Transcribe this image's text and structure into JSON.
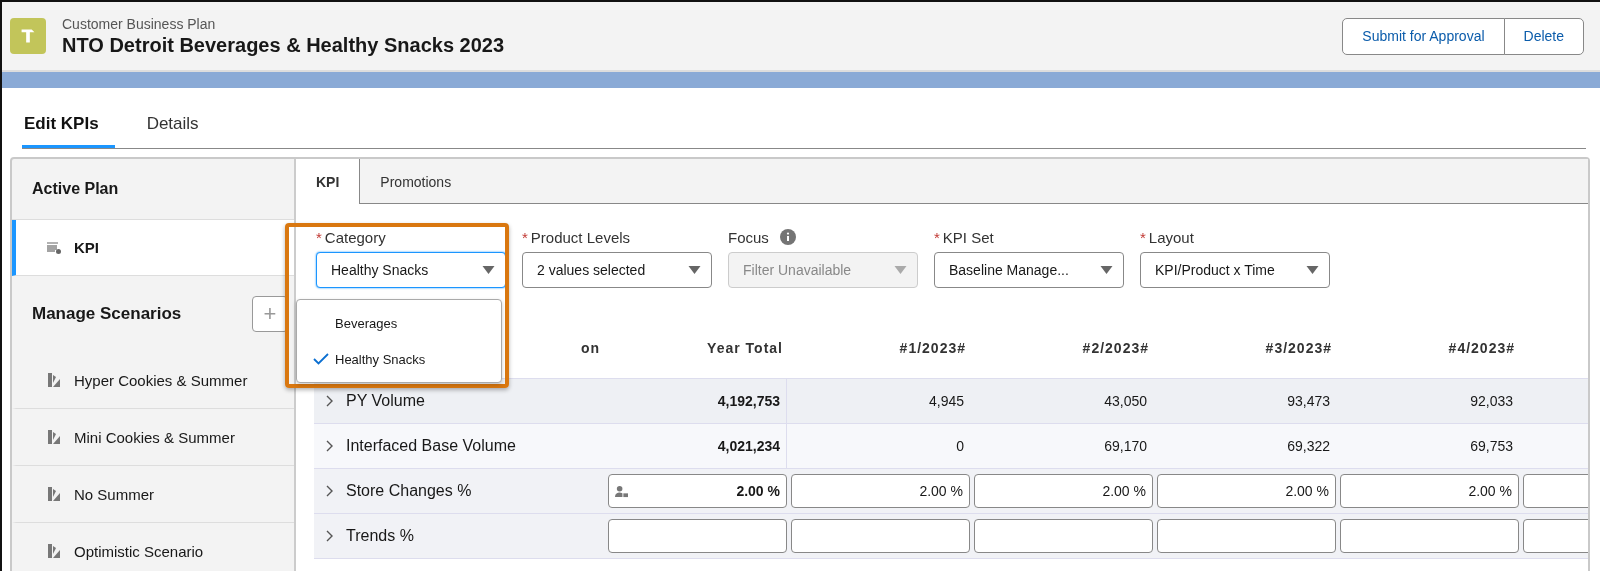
{
  "header": {
    "object_type": "Customer Business Plan",
    "title": "NTO Detroit Beverages & Healthy Snacks 2023",
    "buttons": [
      "Submit for Approval",
      "Delete"
    ]
  },
  "page_tabs": [
    {
      "label": "Edit KPIs",
      "selected": true
    },
    {
      "label": "Details",
      "selected": false
    }
  ],
  "sidebar": {
    "active_plan": {
      "heading": "Active Plan",
      "items": [
        {
          "label": "KPI",
          "selected": true
        }
      ]
    },
    "scenarios": {
      "heading": "Manage Scenarios",
      "add_button": "+",
      "items": [
        {
          "label": "Hyper Cookies & Summer",
          "selected": false
        },
        {
          "label": "Mini Cookies & Summer",
          "selected": false
        },
        {
          "label": "No Summer",
          "selected": false
        },
        {
          "label": "Optimistic Scenario",
          "selected": false
        }
      ]
    }
  },
  "panel_tabs": [
    {
      "label": "KPI",
      "selected": true
    },
    {
      "label": "Promotions",
      "selected": false
    }
  ],
  "filters": [
    {
      "required_mark": "*",
      "label": "Category",
      "value": "Healthy Snacks",
      "disabled": false,
      "focused": true
    },
    {
      "required_mark": "*",
      "label": "Product Levels",
      "value": "2 values selected",
      "disabled": false,
      "focused": false
    },
    {
      "label": "Focus",
      "value": "Filter Unavailable",
      "disabled": true,
      "focused": false,
      "info": true
    },
    {
      "required_mark": "*",
      "label": "KPI Set",
      "value": "Baseline Manage...",
      "disabled": false,
      "focused": false
    },
    {
      "required_mark": "*",
      "label": "Layout",
      "value": "KPI/Product x Time",
      "disabled": false,
      "focused": false
    }
  ],
  "category_menu": [
    {
      "label": "Beverages",
      "selected": false
    },
    {
      "label": "Healthy Snacks",
      "selected": true
    }
  ],
  "table": {
    "columns": [
      "on",
      "Year Total",
      "#1/2023#",
      "#2/2023#",
      "#3/2023#",
      "#4/2023#"
    ],
    "rows": [
      {
        "kind": "value",
        "cells": [
          "PY Volume",
          "4,192,753",
          "4,945",
          "43,050",
          "93,473",
          "92,033"
        ]
      },
      {
        "kind": "value",
        "cells": [
          "Interfaced Base Volume",
          "4,021,234",
          "0",
          "69,170",
          "69,322",
          "69,753"
        ]
      },
      {
        "kind": "input",
        "cells": [
          "Store Changes %",
          "2.00 %",
          "2.00 %",
          "2.00 %",
          "2.00 %",
          "2.00 %"
        ]
      },
      {
        "kind": "input",
        "cells": [
          "Trends %",
          "",
          "",
          "",
          "",
          ""
        ]
      }
    ]
  }
}
